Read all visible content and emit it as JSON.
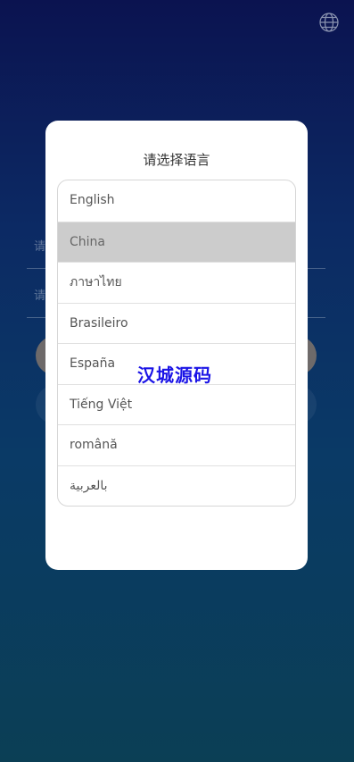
{
  "header": {
    "globe_icon": "globe-icon"
  },
  "background_form": {
    "field1_hint": "请",
    "field2_hint": "请"
  },
  "modal": {
    "title": "请选择语言",
    "languages": [
      {
        "label": "English",
        "selected": false
      },
      {
        "label": "China",
        "selected": true
      },
      {
        "label": "ภาษาไทย",
        "selected": false
      },
      {
        "label": "Brasileiro",
        "selected": false
      },
      {
        "label": "España",
        "selected": false
      },
      {
        "label": "Tiếng Việt",
        "selected": false
      },
      {
        "label": "română",
        "selected": false
      },
      {
        "label": "بالعربية",
        "selected": false
      }
    ]
  },
  "watermark": {
    "text": "汉城源码"
  },
  "colors": {
    "selected_bg": "#cccccc",
    "watermark": "#1b14e6"
  }
}
